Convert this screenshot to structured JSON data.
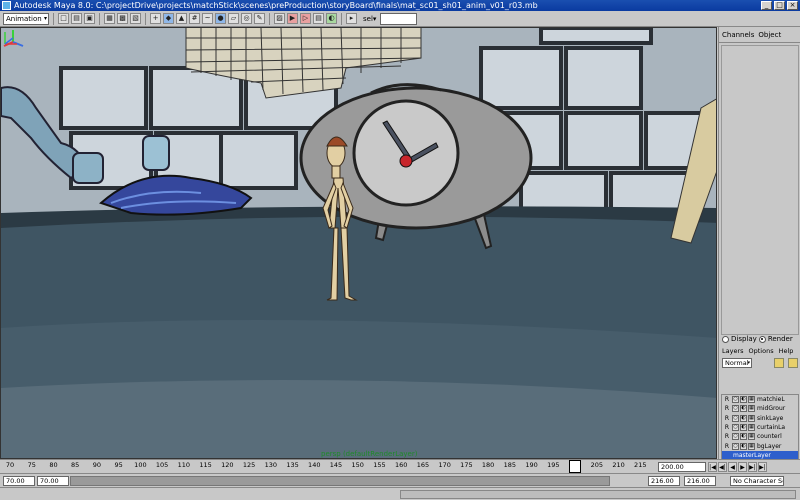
{
  "window": {
    "title": "Autodesk Maya 8.0: C:\\projectDrive\\projects\\matchStick\\scenes\\preProduction\\storyBoard\\finals\\mat_sc01_sh01_anim_v01_r03.mb",
    "minimize": "_",
    "maximize": "□",
    "close": "×"
  },
  "toolbar": {
    "menu_set": "Animation",
    "menu_set_arrow": "▾",
    "icons": [
      "new-scene-icon",
      "open-scene-icon",
      "save-scene-icon",
      "select-hierarchy-icon",
      "select-object-icon",
      "select-component-icon",
      "lock-selection-icon",
      "snap-grid-icon",
      "snap-curve-icon",
      "snap-point-icon",
      "snap-plane-icon",
      "make-live-icon",
      "history-icon",
      "render-icon",
      "ipr-icon",
      "render-settings-icon",
      "hypershade-icon"
    ],
    "sel_label": "sel▾"
  },
  "viewport": {
    "camera_label": "persp (defaultRenderLayer)",
    "colors": {
      "floor": "#3f5563",
      "wall": "#cfd6dc",
      "clock": "#8c8c8c",
      "hand": "#4a5160"
    }
  },
  "channel_box": {
    "tab_channels": "Channels",
    "tab_object": "Object"
  },
  "layer_editor": {
    "radio_display": "Display",
    "radio_render": "Render",
    "menus": [
      "Layers",
      "Options",
      "Help"
    ],
    "blend_mode": "Normal",
    "blend_arrow": "▾",
    "layers": [
      {
        "r": "R",
        "name": "matchieL",
        "selected": false
      },
      {
        "r": "R",
        "name": "midGrour",
        "selected": false
      },
      {
        "r": "R",
        "name": "sinkLaye",
        "selected": false
      },
      {
        "r": "R",
        "name": "curtainLa",
        "selected": false
      },
      {
        "r": "R",
        "name": "counterl",
        "selected": false
      },
      {
        "r": "R",
        "name": "bgLayer",
        "selected": false
      },
      {
        "r": "",
        "name": "masterLayer",
        "selected": true
      }
    ]
  },
  "timeline": {
    "ticks": [
      "70",
      "75",
      "80",
      "85",
      "90",
      "95",
      "100",
      "105",
      "110",
      "115",
      "120",
      "125",
      "130",
      "135",
      "140",
      "145",
      "150",
      "155",
      "160",
      "165",
      "170",
      "175",
      "180",
      "185",
      "190",
      "195",
      "200",
      "205",
      "210",
      "215"
    ],
    "current_frame": "200",
    "end_field": "200.00",
    "transport": [
      "|◀",
      "◀|",
      "◀",
      "▶",
      "▶|",
      "▶|"
    ]
  },
  "range": {
    "start_outer": "70.00",
    "start_inner": "70.00",
    "end_inner": "216.00",
    "end_outer": "216.00",
    "character_set": "No Character Set"
  }
}
